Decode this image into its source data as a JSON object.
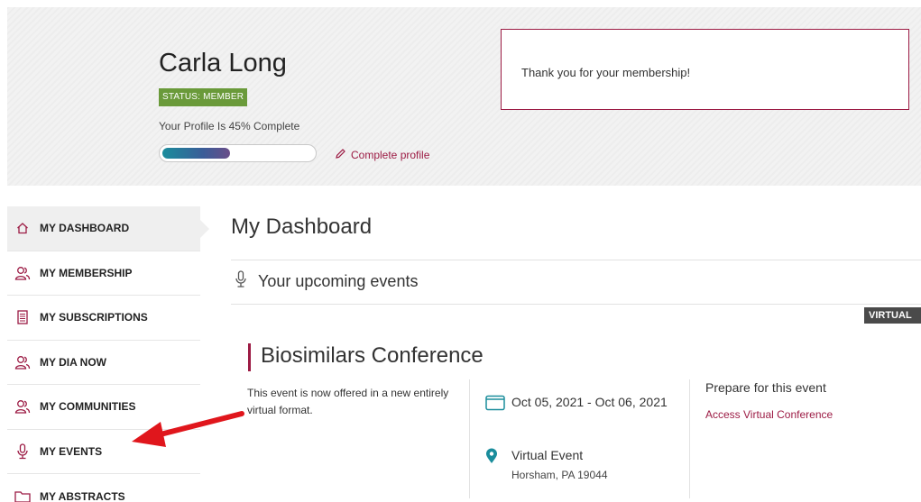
{
  "profile": {
    "name": "Carla Long",
    "status": "STATUS: MEMBER",
    "completion_text": "Your Profile Is 45% Complete",
    "completion_percent": 45,
    "complete_link": "Complete profile"
  },
  "notice": "Thank you for your membership!",
  "sidebar": {
    "items": [
      {
        "label": "MY DASHBOARD",
        "icon": "home-icon"
      },
      {
        "label": "MY MEMBERSHIP",
        "icon": "users-icon"
      },
      {
        "label": "MY SUBSCRIPTIONS",
        "icon": "document-icon"
      },
      {
        "label": "MY DIA NOW",
        "icon": "users-icon"
      },
      {
        "label": "MY COMMUNITIES",
        "icon": "users-icon"
      },
      {
        "label": "MY EVENTS",
        "icon": "microphone-icon"
      },
      {
        "label": "MY ABSTRACTS",
        "icon": "folder-icon"
      }
    ]
  },
  "main": {
    "title": "My Dashboard",
    "section_title": "Your upcoming events",
    "event": {
      "badge": "VIRTUAL",
      "title": "Biosimilars Conference",
      "description": "This event is now offered in a new entirely virtual format.",
      "date": "Oct 05, 2021 - Oct 06, 2021",
      "location": "Virtual Event",
      "address": "Horsham, PA 19044",
      "prepare_label": "Prepare for this event",
      "access_link": "Access Virtual Conference"
    }
  },
  "colors": {
    "accent": "#9c1b44",
    "status_green": "#6a9a3a",
    "teal": "#1a8d9c",
    "arrow_red": "#e0161c"
  }
}
